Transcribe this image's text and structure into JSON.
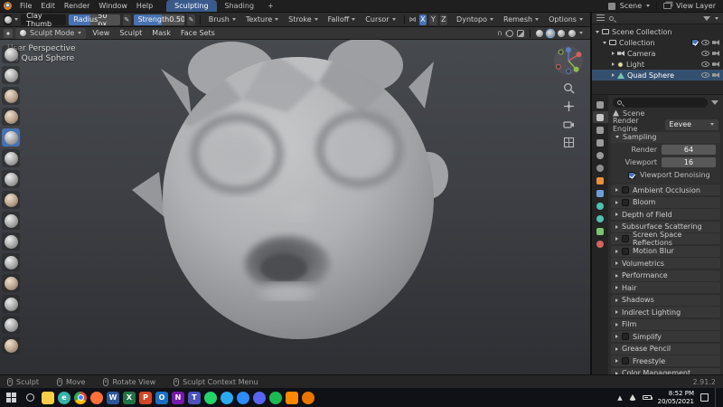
{
  "theme": {
    "accent": "#4772b3",
    "active_workspace_tab": "#3a5a8c",
    "selection_row": "#34506e"
  },
  "topbar": {
    "menus": [
      "File",
      "Edit",
      "Render",
      "Window",
      "Help"
    ],
    "workspaces": [
      {
        "label": "Sculpting",
        "active": true
      },
      {
        "label": "Shading",
        "active": false
      }
    ],
    "add_tab": "+",
    "scene_label": "Scene",
    "view_layer_label": "View Layer"
  },
  "tools": {
    "brush": "Clay Thumb",
    "radius_label": "Radius",
    "radius_value": "50 px",
    "strength_label": "Strength",
    "strength_value": "0.500",
    "pressure_icon": "✎",
    "menus": [
      "Brush",
      "Texture",
      "Stroke",
      "Falloff",
      "Cursor"
    ],
    "symmetry": [
      "X",
      "Y",
      "Z"
    ],
    "right_menus": [
      "Dyntopo",
      "Remesh",
      "Options"
    ]
  },
  "view_header": {
    "mode": "Sculpt Mode",
    "menus": [
      "View",
      "Sculpt",
      "Mask",
      "Face Sets"
    ]
  },
  "viewport": {
    "overlay_line1": "User Perspective",
    "overlay_line2": "(1) Quad Sphere"
  },
  "brushes": [
    "Draw",
    "Draw Sharp",
    "Clay",
    "Clay Strips",
    "Clay Thumb",
    "Layer",
    "Inflate",
    "Blob",
    "Crease",
    "Smooth",
    "Flatten",
    "Fill",
    "Scrape",
    "Pinch",
    "Grab"
  ],
  "outliner": {
    "scene_collection": "Scene Collection",
    "collection": "Collection",
    "objects": [
      {
        "label": "Camera"
      },
      {
        "label": "Light"
      },
      {
        "label": "Quad Sphere",
        "selected": true
      }
    ]
  },
  "properties": {
    "breadcrumb": "Scene",
    "engine_label": "Render Engine",
    "engine_value": "Eevee",
    "sampling": {
      "title": "Sampling",
      "render_label": "Render",
      "render_value": "64",
      "viewport_label": "Viewport",
      "viewport_value": "16",
      "denoise_label": "Viewport Denoising",
      "denoise_checked": true
    },
    "sections": [
      {
        "label": "Ambient Occlusion",
        "checkbox": true
      },
      {
        "label": "Bloom",
        "checkbox": true
      },
      {
        "label": "Depth of Field",
        "checkbox": false
      },
      {
        "label": "Subsurface Scattering",
        "checkbox": false
      },
      {
        "label": "Screen Space Reflections",
        "checkbox": true
      },
      {
        "label": "Motion Blur",
        "checkbox": true
      },
      {
        "label": "Volumetrics",
        "checkbox": false
      },
      {
        "label": "Performance",
        "checkbox": false
      },
      {
        "label": "Hair",
        "checkbox": false
      },
      {
        "label": "Shadows",
        "checkbox": false
      },
      {
        "label": "Indirect Lighting",
        "checkbox": false
      },
      {
        "label": "Film",
        "checkbox": false
      },
      {
        "label": "Simplify",
        "checkbox": true
      },
      {
        "label": "Grease Pencil",
        "checkbox": false
      },
      {
        "label": "Freestyle",
        "checkbox": true
      },
      {
        "label": "Color Management",
        "checkbox": false
      }
    ]
  },
  "status": {
    "items": [
      "Sculpt",
      "Move",
      "Rotate View",
      "Sculpt Context Menu"
    ],
    "version": "2.91.2"
  },
  "taskbar": {
    "time": "8:52 PM",
    "date": "20/05/2021",
    "apps": [
      {
        "name": "file-explorer",
        "color": "#f8ce46",
        "letter": ""
      },
      {
        "name": "edge",
        "color": "#35b3a8",
        "letter": "e"
      },
      {
        "name": "chrome",
        "color": "#4285f4",
        "letter": ""
      },
      {
        "name": "firefox",
        "color": "#ff7139",
        "letter": ""
      },
      {
        "name": "word",
        "color": "#2b579a",
        "letter": "W"
      },
      {
        "name": "excel",
        "color": "#217346",
        "letter": "X"
      },
      {
        "name": "powerpoint",
        "color": "#d24726",
        "letter": "P"
      },
      {
        "name": "outlook",
        "color": "#1a6fc4",
        "letter": "O"
      },
      {
        "name": "onenote",
        "color": "#7719aa",
        "letter": "N"
      },
      {
        "name": "teams",
        "color": "#4b53bc",
        "letter": "T"
      },
      {
        "name": "whatsapp",
        "color": "#25d366",
        "letter": ""
      },
      {
        "name": "telegram",
        "color": "#2aabee",
        "letter": ""
      },
      {
        "name": "zoom",
        "color": "#2d8cff",
        "letter": ""
      },
      {
        "name": "discord",
        "color": "#5865f2",
        "letter": ""
      },
      {
        "name": "spotify",
        "color": "#1db954",
        "letter": ""
      },
      {
        "name": "vlc",
        "color": "#ff8800",
        "letter": ""
      },
      {
        "name": "blender",
        "color": "#ea7600",
        "letter": ""
      }
    ]
  }
}
